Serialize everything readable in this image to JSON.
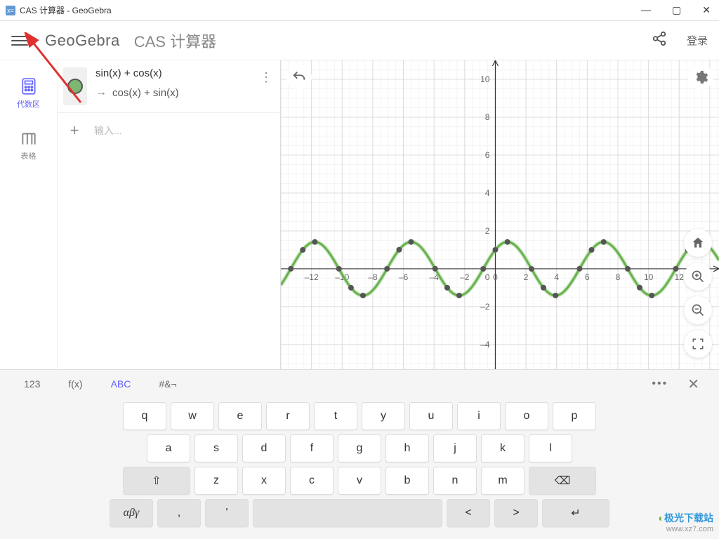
{
  "window": {
    "title": "CAS 计算器 - GeoGebra"
  },
  "appbar": {
    "brand": "GeoGebra",
    "title": "CAS 计算器",
    "login": "登录"
  },
  "sidebar": {
    "items": [
      {
        "label": "代数区",
        "icon": "calculator"
      },
      {
        "label": "表格",
        "icon": "table"
      }
    ]
  },
  "algebra": {
    "expressions": [
      {
        "input": "sin(x) + cos(x)",
        "output": "cos(x) + sin(x)"
      }
    ],
    "input_placeholder": "输入..."
  },
  "keyboard": {
    "tabs": [
      "123",
      "f(x)",
      "ABC",
      "#&¬"
    ],
    "active_tab": "ABC",
    "rows": [
      [
        "q",
        "w",
        "e",
        "r",
        "t",
        "y",
        "u",
        "i",
        "o",
        "p"
      ],
      [
        "a",
        "s",
        "d",
        "f",
        "g",
        "h",
        "j",
        "k",
        "l"
      ],
      [
        "⇧",
        "z",
        "x",
        "c",
        "v",
        "b",
        "n",
        "m",
        "⌫"
      ],
      [
        "αβγ",
        ",",
        "'",
        " ",
        "<",
        ">",
        "↵"
      ]
    ]
  },
  "chart_data": {
    "type": "line",
    "function": "sin(x)+cos(x)",
    "title": "",
    "xlabel": "",
    "ylabel": "",
    "xlim": [
      -14,
      14.6
    ],
    "ylim": [
      -5.3,
      11
    ],
    "x_ticks": [
      -12,
      -10,
      -8,
      -6,
      -4,
      -2,
      0,
      2,
      4,
      6,
      8,
      10,
      12
    ],
    "y_ticks": [
      -4,
      -2,
      2,
      4,
      6,
      8,
      10
    ],
    "special_points_x": [
      -13.35,
      -12.57,
      -11.78,
      -10.21,
      -9.42,
      -8.64,
      -7.07,
      -6.28,
      -5.5,
      -3.93,
      -3.14,
      -2.36,
      -0.79,
      0,
      0.79,
      2.36,
      3.14,
      3.93,
      5.5,
      6.28,
      7.07,
      8.64,
      9.42,
      10.21,
      11.78,
      12.57,
      13.35
    ]
  },
  "watermark": {
    "brand": "极光下载站",
    "url": "www.xz7.com"
  }
}
